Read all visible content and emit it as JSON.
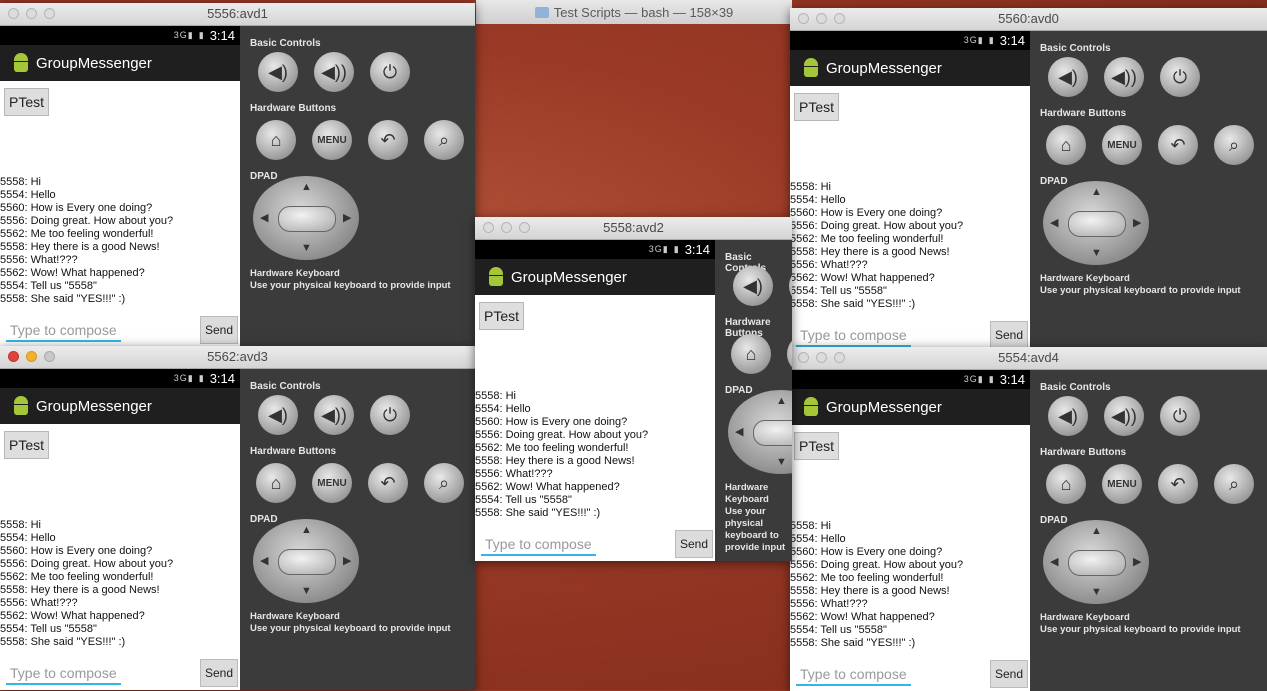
{
  "terminal_title": "Test Scripts — bash — 158×39",
  "app": {
    "name": "GroupMessenger",
    "time": "3:14",
    "ptest_label": "PTest",
    "compose_placeholder": "Type to compose",
    "send_label": "Send"
  },
  "controls": {
    "basic": "Basic Controls",
    "hardware": "Hardware Buttons",
    "dpad": "DPAD",
    "keyboard_title": "Hardware Keyboard",
    "keyboard_hint": "Use your physical keyboard to provide input",
    "menu_label": "MENU"
  },
  "messages": [
    "5558: Hi",
    "5554: Hello",
    "5560: How is Every one doing?",
    "5556: Doing great. How about you?",
    "5562: Me too feeling wonderful!",
    "5558: Hey there is a good News!",
    "5556: What!???",
    "5562: Wow! What happened?",
    "5554: Tell us \"5558\"",
    "5558: She said \"YES!!!\" :)"
  ],
  "windows": [
    {
      "title": "5556:avd1"
    },
    {
      "title": "5560:avd0"
    },
    {
      "title": "5558:avd2"
    },
    {
      "title": "5562:avd3"
    },
    {
      "title": "5554:avd4"
    }
  ]
}
